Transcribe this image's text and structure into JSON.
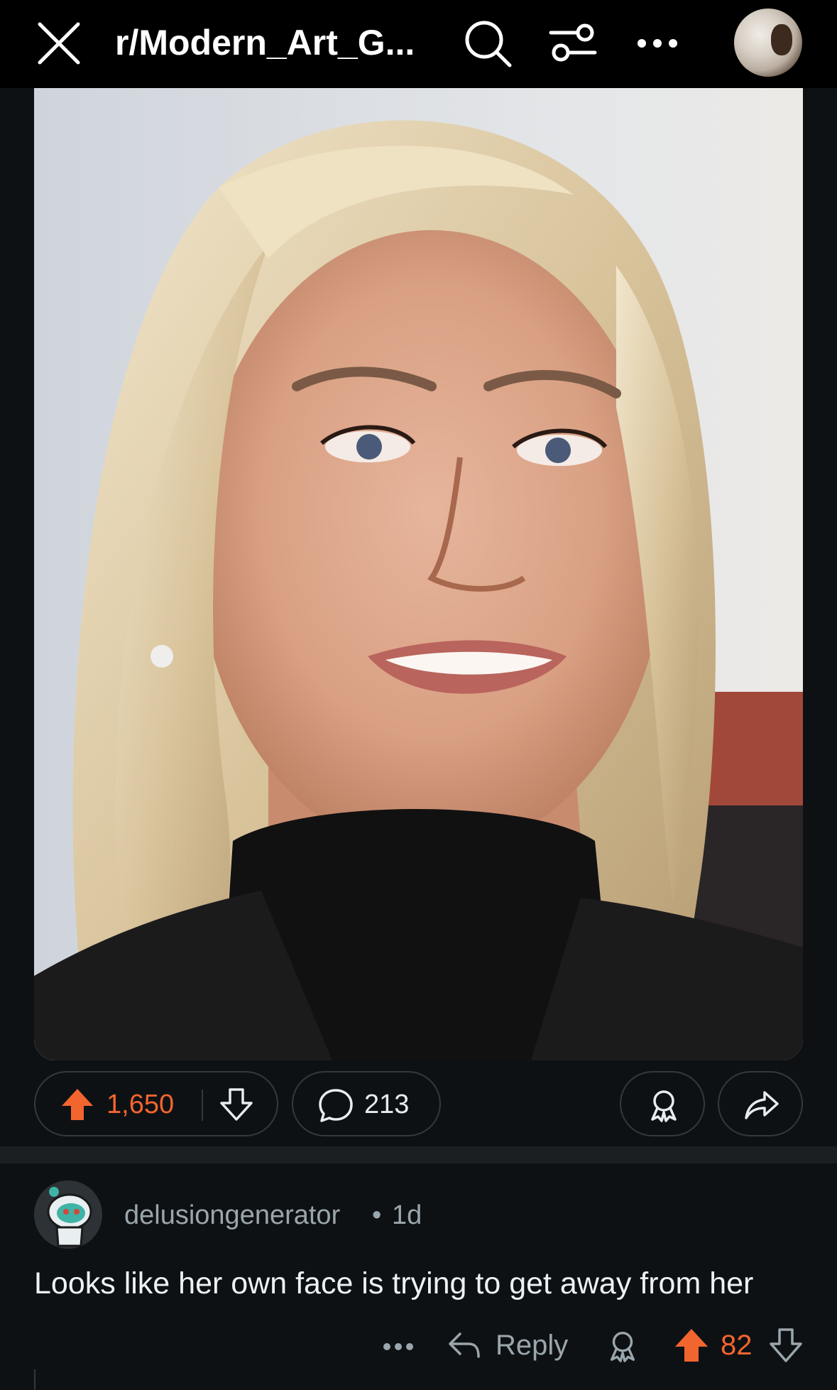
{
  "header": {
    "title": "r/Modern_Art_G...",
    "icons": [
      "close-icon",
      "search-icon",
      "filter-icon",
      "more-icon",
      "avatar"
    ]
  },
  "post": {
    "image_alt": "photo",
    "upvotes": "1,650",
    "comments": "213",
    "upvote_color": "#f3652f"
  },
  "comment": {
    "author": "delusiongenerator",
    "separator": "•",
    "age": "1d",
    "text": "Looks like her own face is trying to get away from her",
    "reply_label": "Reply",
    "votes": "82"
  },
  "colors": {
    "background": "#0e1113",
    "topbar": "#000000",
    "accent": "#f3652f",
    "muted": "#9aa6ad"
  }
}
